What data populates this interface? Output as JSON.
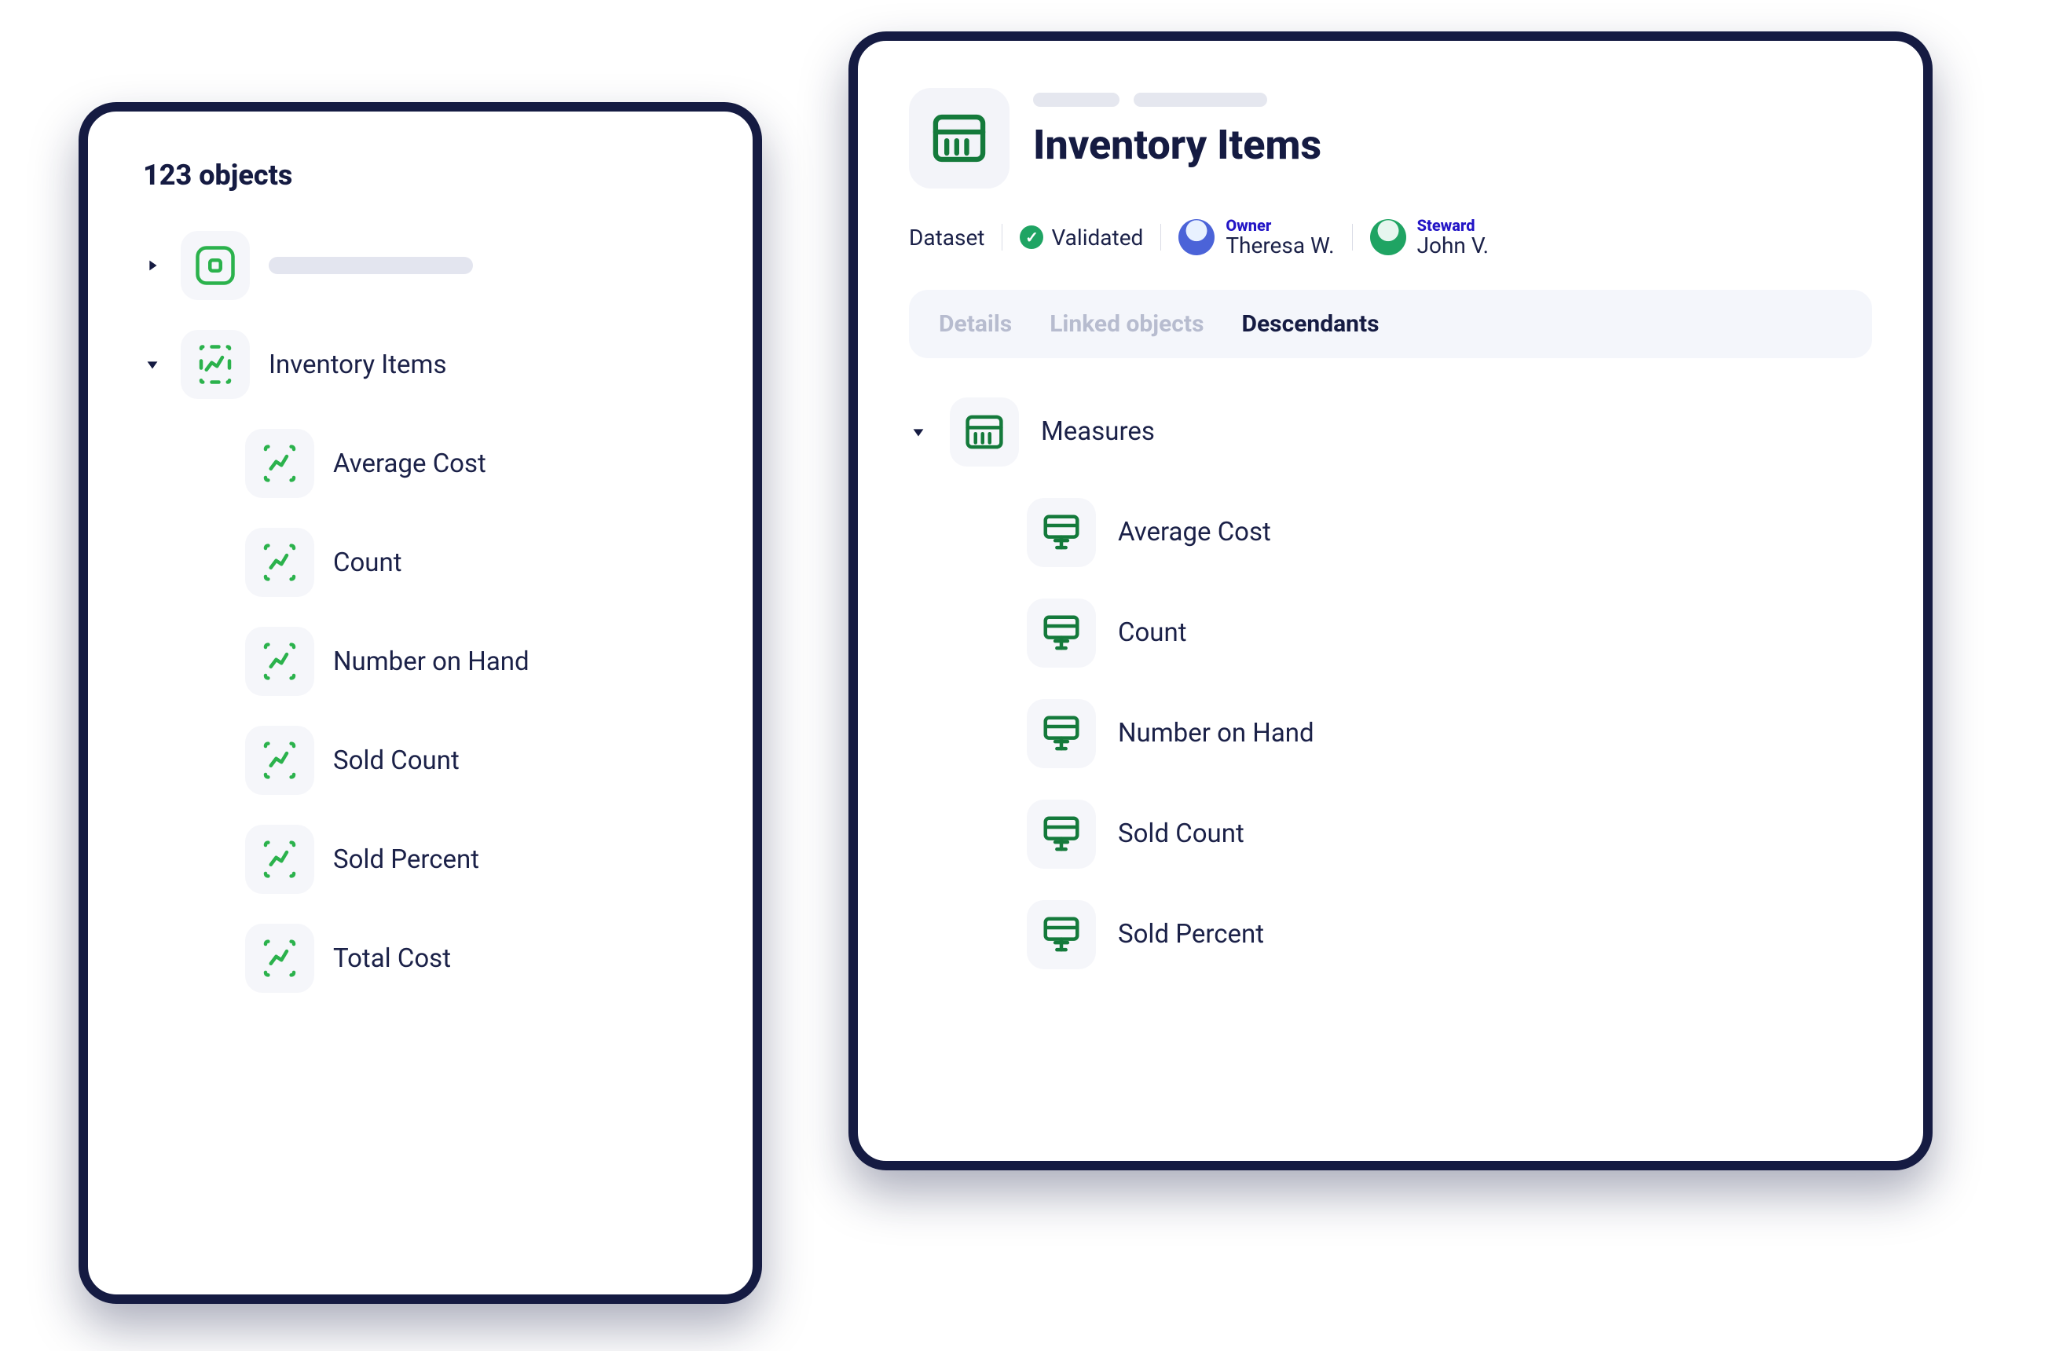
{
  "leftPanel": {
    "header": "123 objects",
    "rows": {
      "inventoryItems": "Inventory Items",
      "children": {
        "avgCost": "Average Cost",
        "count": "Count",
        "numOnHand": "Number on Hand",
        "soldCount": "Sold Count",
        "soldPercent": "Sold Percent",
        "totalCost": "Total Cost"
      }
    }
  },
  "rightPanel": {
    "title": "Inventory Items",
    "meta": {
      "type": "Dataset",
      "status": "Validated",
      "owner": {
        "role": "Owner",
        "name": "Theresa W."
      },
      "steward": {
        "role": "Steward",
        "name": "John V."
      }
    },
    "tabs": {
      "details": "Details",
      "linked": "Linked objects",
      "descendants": "Descendants"
    },
    "tree": {
      "measures": "Measures",
      "children": {
        "avgCost": "Average Cost",
        "count": "Count",
        "numOnHand": "Number on Hand",
        "soldCount": "Sold Count",
        "soldPercent": "Sold Percent"
      }
    }
  }
}
